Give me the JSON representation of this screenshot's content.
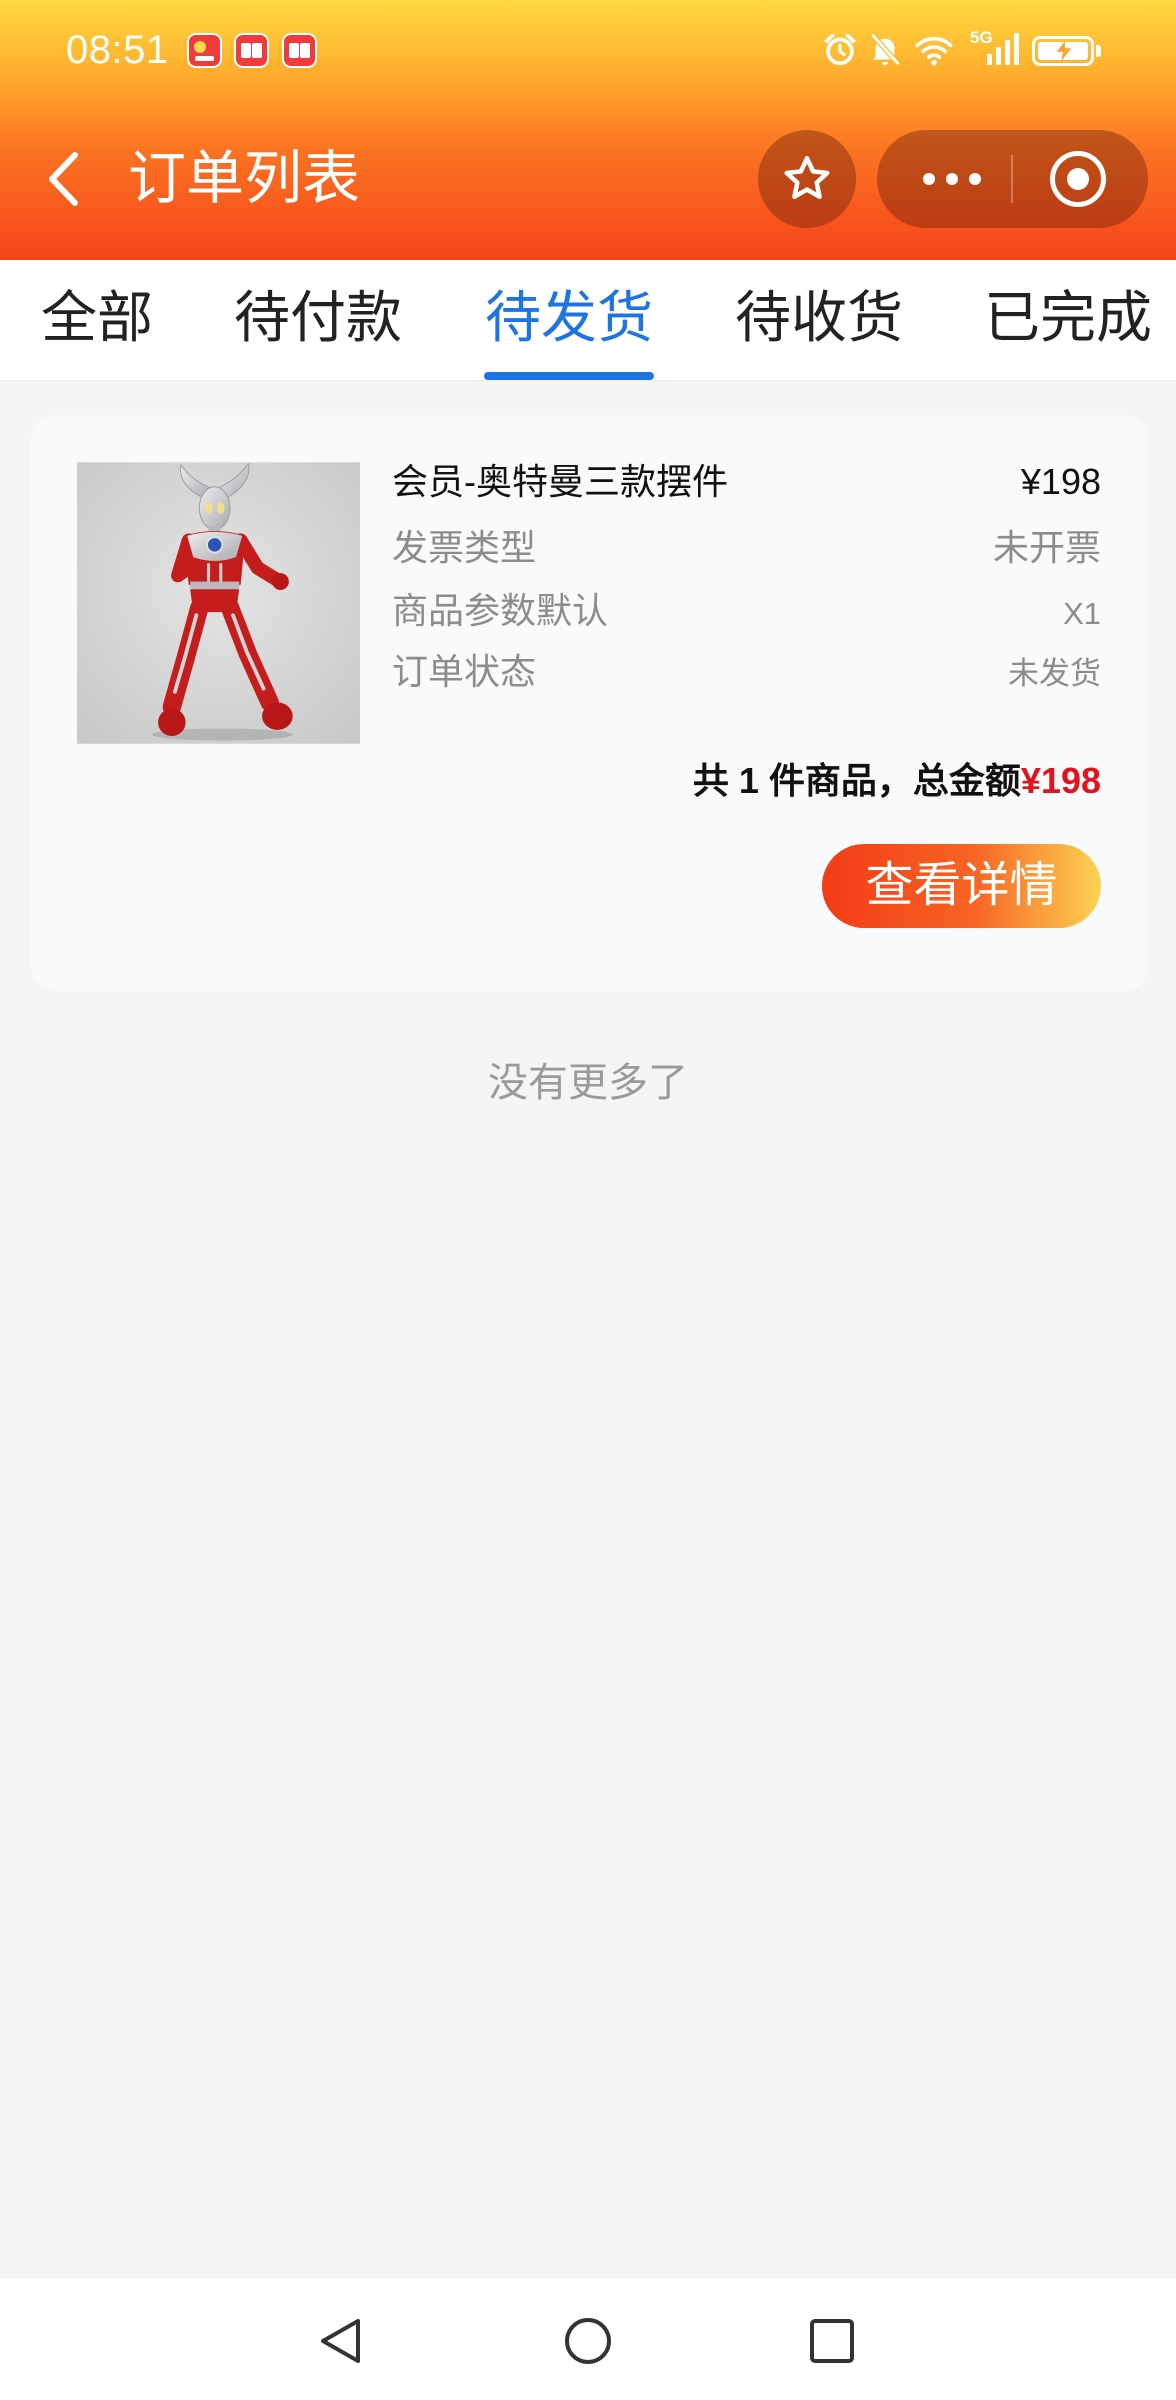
{
  "status_bar": {
    "time": "08:51",
    "network": "5G",
    "app_icons": [
      "app-notification-icon",
      "book-app-icon",
      "book-app-icon"
    ],
    "icons": [
      "alarm-icon",
      "bell-off-icon",
      "wifi-icon",
      "signal-icon",
      "battery-charging-icon"
    ]
  },
  "header": {
    "title": "订单列表",
    "icons": {
      "back": "chevron-left-icon",
      "favorite": "star-icon",
      "more": "more-dots-icon",
      "close": "target-icon"
    }
  },
  "tabs": [
    {
      "label": "全部"
    },
    {
      "label": "待付款"
    },
    {
      "label": "待发货",
      "active": true
    },
    {
      "label": "待收货"
    },
    {
      "label": "已完成"
    }
  ],
  "order": {
    "title": "会员-奥特曼三款摆件",
    "price": "¥198",
    "details": [
      {
        "label": "发票类型",
        "value": "未开票"
      },
      {
        "label": "商品参数默认",
        "value": "X1"
      },
      {
        "label": "订单状态",
        "value": "未发货"
      }
    ],
    "summary_text": "共 1 件商品，总金额",
    "total": "¥198",
    "detail_button": "查看详情"
  },
  "list_end_text": "没有更多了",
  "nav_bar": {
    "icons": [
      "back-triangle-icon",
      "home-circle-icon",
      "recents-square-icon"
    ]
  },
  "colors": {
    "accent": "#1f74e3",
    "price_red": "#e5121c",
    "header_top": "#ffd940",
    "header_bottom": "#f5441a",
    "button_start": "#f33b16",
    "button_end": "#fdd353"
  }
}
